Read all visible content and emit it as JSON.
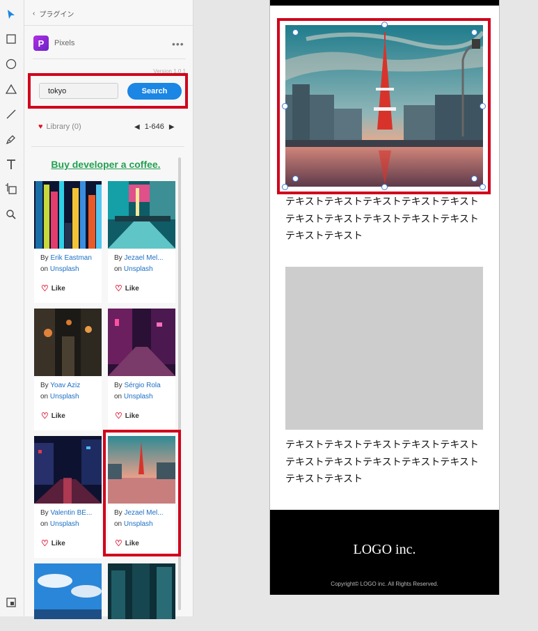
{
  "panel": {
    "back_label": "プラグイン",
    "plugin_logo_letter": "P",
    "plugin_name": "Pixels",
    "more": "•••",
    "version": "Version 1.0.1",
    "search_value": "tokyo",
    "search_button": "Search",
    "library_label": "Library (0)",
    "page_range": "1-646",
    "coffee_link": "Buy developer a coffee.",
    "photos": [
      {
        "by": "By",
        "author": "Erik Eastman",
        "on": "on",
        "source": "Unsplash",
        "like": "Like"
      },
      {
        "by": "By",
        "author": "Jezael Mel...",
        "on": "on",
        "source": "Unsplash",
        "like": "Like"
      },
      {
        "by": "By",
        "author": "Yoav Aziz",
        "on": "on",
        "source": "Unsplash",
        "like": "Like"
      },
      {
        "by": "By",
        "author": "Sérgio Rola",
        "on": "on",
        "source": "Unsplash",
        "like": "Like"
      },
      {
        "by": "By",
        "author": "Valentin BE...",
        "on": "on",
        "source": "Unsplash",
        "like": "Like"
      },
      {
        "by": "By",
        "author": "Jezael Mel...",
        "on": "on",
        "source": "Unsplash",
        "like": "Like"
      }
    ]
  },
  "artboard": {
    "text1": "テキストテキストテキストテキストテキストテキストテキストテキストテキストテキストテキストテキスト",
    "text2": "テキストテキストテキストテキストテキストテキストテキストテキストテキストテキストテキストテキスト",
    "logo": "LOGO inc.",
    "copyright": "Copyright© LOGO inc. All Rights Reserved."
  },
  "colors": {
    "accent": "#1b86e3",
    "highlight": "#d0021b",
    "coffee": "#20a050"
  },
  "icons": [
    "select-arrow-icon",
    "rectangle-icon",
    "ellipse-icon",
    "triangle-icon",
    "line-icon",
    "pen-icon",
    "text-icon",
    "artboard-icon",
    "zoom-icon",
    "plugins-icon",
    "heart-icon",
    "chevron-left-icon",
    "chevron-right-icon"
  ]
}
